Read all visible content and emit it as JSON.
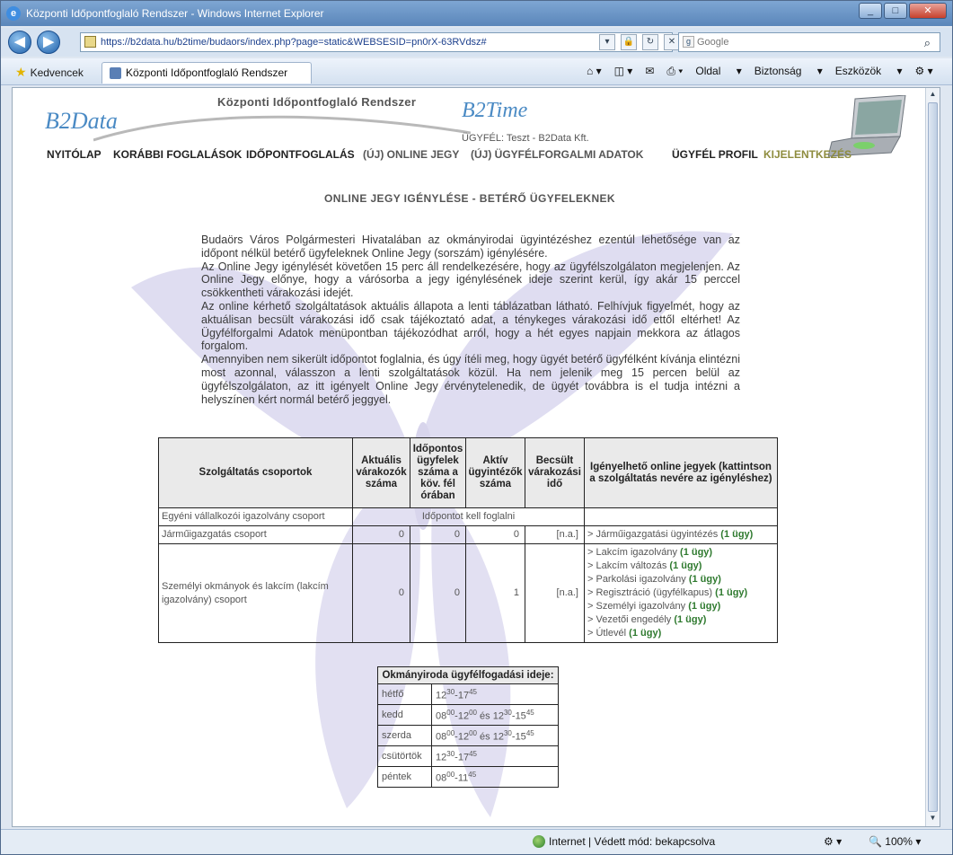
{
  "window": {
    "title": "Központi Időpontfoglaló Rendszer - Windows Internet Explorer",
    "min": "_",
    "max": "□",
    "close": "✕"
  },
  "address": {
    "url": "https://b2data.hu/b2time/budaors/index.php?page=static&WEBSESID=pn0rX-63RVdsz#",
    "search_placeholder": "Google"
  },
  "toolbar": {
    "favorites": "Kedvencek",
    "tab_title": "Központi Időpontfoglaló Rendszer",
    "page": "Oldal",
    "security": "Biztonság",
    "tools": "Eszközök"
  },
  "header": {
    "title": "Központi Időpontfoglaló Rendszer",
    "logo_left": "B2Data",
    "logo_right": "B2Time",
    "client": "ÜGYFÉL: Teszt - B2Data Kft."
  },
  "nav": {
    "home": "NYITÓLAP",
    "history": "KORÁBBI FOGLALÁSOK",
    "booking": "IDŐPONTFOGLALÁS",
    "online": "(ÚJ) ONLINE JEGY",
    "traffic": "(ÚJ) ÜGYFÉLFORGALMI ADATOK",
    "profile": "ÜGYFÉL PROFIL",
    "logout": "KIJELENTKEZÉS"
  },
  "main": {
    "heading": "ONLINE JEGY IGÉNYLÉSE - BETÉRŐ ÜGYFELEKNEK",
    "intro": [
      "Budaörs Város Polgármesteri Hivatalában az okmányirodai ügyintézéshez ezentúl lehetősége van az időpont nélkül betérő ügyfeleknek Online Jegy (sorszám) igénylésére.",
      "Az Online Jegy igénylését követően 15 perc áll rendelkezésére, hogy az ügyfélszolgálaton megjelenjen. Az Online Jegy előnye, hogy a várósorba a jegy igénylésének ideje szerint kerül, így akár 15 perccel csökkentheti várakozási idejét.",
      "Az online kérhető szolgáltatások aktuális állapota a lenti táblázatban látható. Felhívjuk figyelmét, hogy az aktuálisan becsült várakozási idő csak tájékoztató adat, a ténykeges várakozási idő ettől eltérhet! Az Ügyfélforgalmi Adatok menüpontban tájékozódhat arról, hogy a hét egyes napjain mekkora az átlagos forgalom.",
      "Amennyiben nem sikerült időpontot foglalnia, és úgy ítéli meg, hogy ügyét betérő ügyfélként kívánja elintézni most azonnal, válasszon a lenti szolgáltatások közül. Ha nem jelenik meg 15 percen belül az ügyfélszolgálaton, az itt igényelt Online Jegy érvénytelenedik, de ügyét továbbra is el tudja intézni a helyszínen kért normál betérő jeggyel."
    ]
  },
  "table": {
    "headers": [
      "Szolgáltatás csoportok",
      "Aktuális várakozók száma",
      "Időpontos ügyfelek száma a köv. fél órában",
      "Aktív ügyintézők száma",
      "Becsült várakozási idő",
      "Igényelhető online jegyek (kattintson a szolgáltatás nevére az igényléshez)"
    ],
    "row1": {
      "group": "Egyéni vállalkozói igazolvány csoport",
      "note": "Időpontot kell foglalni"
    },
    "row2": {
      "group": "Járműigazgatás csoport",
      "waiting": "0",
      "booked": "0",
      "active": "0",
      "est": "[n.a.]",
      "link": "> Járműigazgatási ügyintézés",
      "count": "(1 ügy)"
    },
    "row3": {
      "group": "Személyi okmányok és lakcím (lakcím igazolvány) csoport",
      "waiting": "0",
      "booked": "0",
      "active": "1",
      "est": "[n.a.]",
      "links": [
        {
          "name": "> Lakcím igazolvány",
          "count": "(1 ügy)"
        },
        {
          "name": "> Lakcím változás",
          "count": "(1 ügy)"
        },
        {
          "name": "> Parkolási igazolvány",
          "count": "(1 ügy)"
        },
        {
          "name": "> Regisztráció (ügyfélkapus)",
          "count": "(1 ügy)"
        },
        {
          "name": "> Személyi igazolvány",
          "count": "(1 ügy)"
        },
        {
          "name": "> Vezetői engedély",
          "count": "(1 ügy)"
        },
        {
          "name": "> Útlevél",
          "count": "(1 ügy)"
        }
      ]
    }
  },
  "hours": {
    "title": "Okmányiroda ügyfélfogadási ideje:",
    "days": [
      {
        "day": "hétfő",
        "h1": "12",
        "m1": "30",
        "h2": "17",
        "m2": "45"
      },
      {
        "day": "kedd",
        "h1": "08",
        "m1": "00",
        "h2": "12",
        "m2": "00",
        "and": "és",
        "h3": "12",
        "m3": "30",
        "h4": "15",
        "m4": "45"
      },
      {
        "day": "szerda",
        "h1": "08",
        "m1": "00",
        "h2": "12",
        "m2": "00",
        "and": "és",
        "h3": "12",
        "m3": "30",
        "h4": "15",
        "m4": "45"
      },
      {
        "day": "csütörtök",
        "h1": "12",
        "m1": "30",
        "h2": "17",
        "m2": "45"
      },
      {
        "day": "péntek",
        "h1": "08",
        "m1": "00",
        "h2": "11",
        "m2": "45"
      }
    ]
  },
  "status": {
    "zone": "Internet | Védett mód: bekapcsolva",
    "zoom": "100%"
  }
}
